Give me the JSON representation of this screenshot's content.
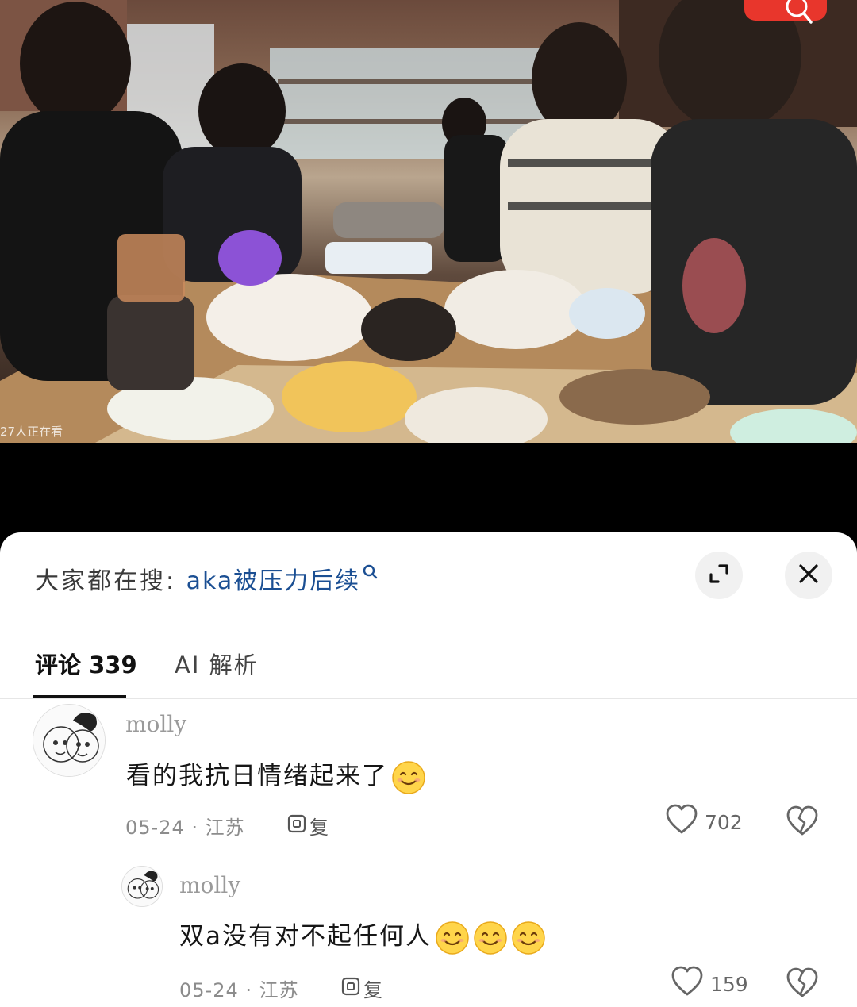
{
  "video": {
    "viewer_count": "27人正在看"
  },
  "sheet": {
    "hot_search_prefix": "大家都在搜:",
    "hot_search_term": "aka被压力后续",
    "icons": {
      "search": "search-icon",
      "expand": "expand-icon",
      "close": "close-icon",
      "like": "heart-outline-icon",
      "dislike": "broken-heart-icon",
      "reply": "reply-icon"
    }
  },
  "tabs": {
    "comments_label": "评论 339",
    "ai_label": "AI 解析"
  },
  "comments": [
    {
      "username": "molly",
      "text": "看的我抗日情绪起来了",
      "emoji_count": 1,
      "date": "05-24",
      "location": "江苏",
      "meta": "05-24 · 江苏",
      "reply_label": "复",
      "likes": "702"
    },
    {
      "username": "molly",
      "text": "双a没有对不起任何人",
      "emoji_count": 3,
      "date": "05-24",
      "location": "江苏",
      "meta": "05-24 · 江苏",
      "reply_label": "复",
      "likes": "159"
    }
  ],
  "colors": {
    "accent_link": "#1b4f93",
    "meta_gray": "#8c8c8c",
    "sheet_bg": "#ffffff"
  }
}
